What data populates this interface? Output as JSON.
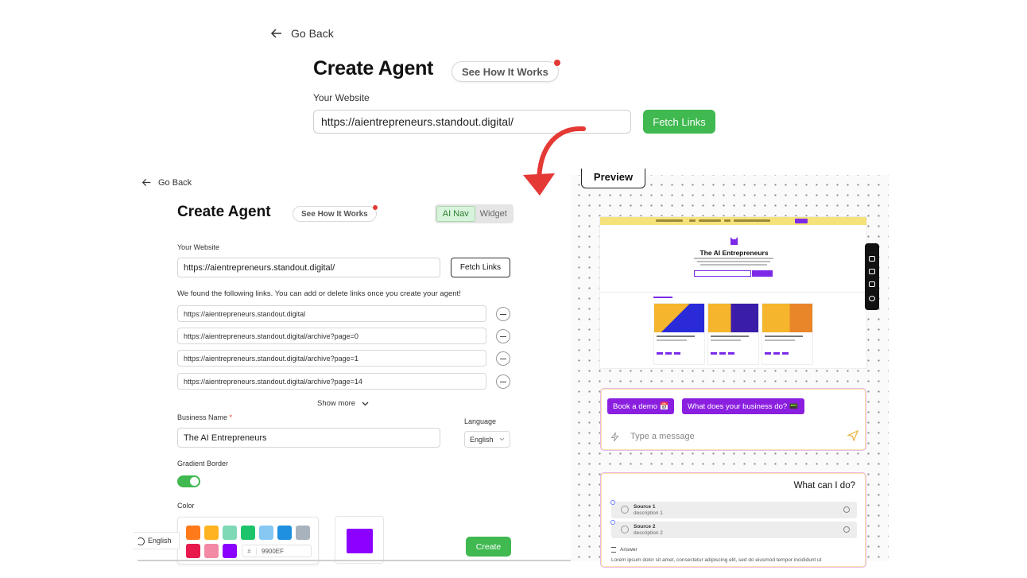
{
  "top": {
    "back_label": "Go Back",
    "title": "Create Agent",
    "how_it_works": "See How It Works",
    "website_label": "Your Website",
    "website_value": "https://aientrepreneurs.standout.digital/",
    "fetch_label": "Fetch Links"
  },
  "form": {
    "back_label": "Go Back",
    "title": "Create Agent",
    "how_it_works": "See How It Works",
    "mode_tabs": [
      "AI Nav",
      "Widget"
    ],
    "website_label": "Your Website",
    "website_value": "https://aientrepreneurs.standout.digital/",
    "fetch_label": "Fetch Links",
    "found_text": "We found the following links. You can add or delete links once you create your agent!",
    "links": [
      "https://aientrepreneurs.standout.digital",
      "https://aientrepreneurs.standout.digital/archive?page=0",
      "https://aientrepreneurs.standout.digital/archive?page=1",
      "https://aientrepreneurs.standout.digital/archive?page=14"
    ],
    "show_more": "Show more",
    "business_name_label": "Business Name",
    "required_mark": "*",
    "business_name_value": "The AI Entrepreneurs",
    "language_label": "Language",
    "language_value": "English",
    "gradient_border_label": "Gradient Border",
    "gradient_border_on": true,
    "color_label": "Color",
    "swatches": [
      "#ff7a1a",
      "#ffb320",
      "#7fd8b6",
      "#1ec46c",
      "#86c8f2",
      "#1f8fe0",
      "#a9b3bd",
      "#e8194d",
      "#f28aa5",
      "#8b00ff"
    ],
    "hex_prefix": "#",
    "hex_value": "9900EF",
    "selected_color": "#8b00ff",
    "create_label": "Create",
    "bottom_language": "English"
  },
  "preview": {
    "tab_label": "Preview",
    "site_title": "The AI Entrepreneurs",
    "chips": [
      "Book a demo 📅",
      "What does your business do? 📟"
    ],
    "chat_placeholder": "Type a message",
    "what_title": "What can I do?",
    "sources": [
      {
        "name": "Source 1",
        "desc": "description 1"
      },
      {
        "name": "Source 2",
        "desc": "description 2"
      }
    ],
    "answer_label": "Answer",
    "answer_text": "Lorem ipsum dolor sit amet, consectetur adipiscing elit, sed do eiusmod tempor incididunt ut"
  },
  "colors": {
    "green": "#3fb950",
    "purple": "#8b1fe0",
    "arrow_red": "#e53935"
  }
}
